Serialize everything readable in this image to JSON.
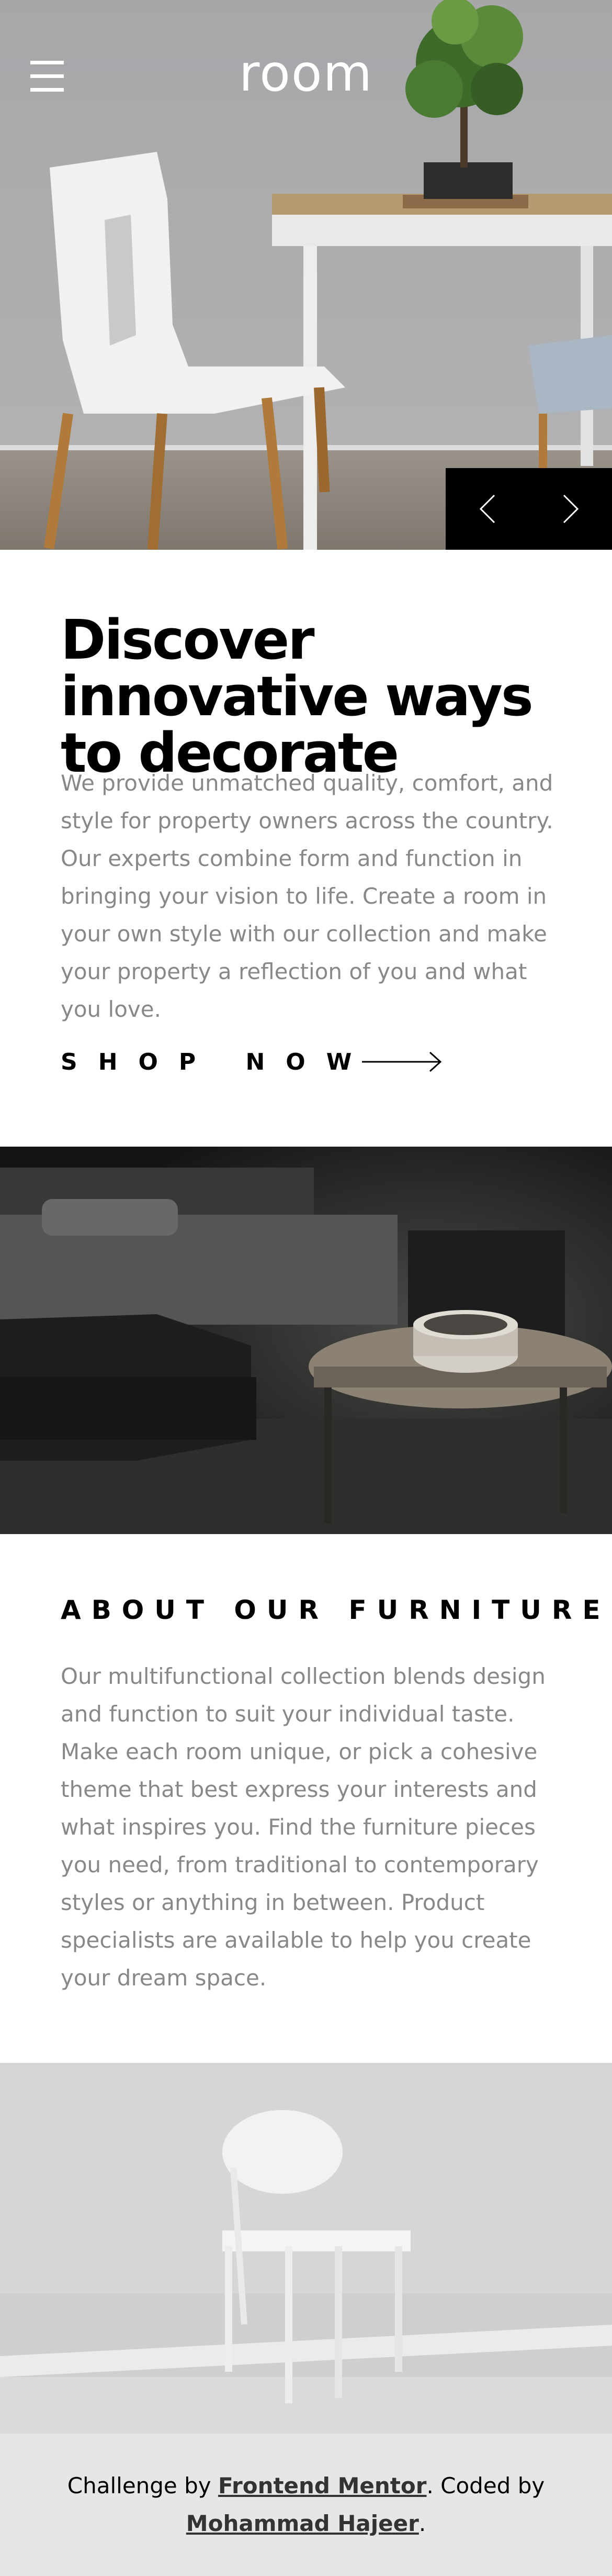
{
  "header": {
    "logo": "room",
    "menu_icon": "hamburger-menu-icon"
  },
  "slider": {
    "prev_icon": "chevron-left-icon",
    "next_icon": "chevron-right-icon"
  },
  "intro": {
    "title": "Discover innovative ways to decorate",
    "body": "We provide unmatched quality, comfort, and style for property owners across the country. Our experts combine form and function in bringing your vision to life. Create a room in your own style with our collection and make your property a reflection of you and what you love.",
    "cta_label": "SHOP NOW",
    "cta_icon": "arrow-right-icon"
  },
  "about": {
    "title": "ABOUT OUR FURNITURE",
    "body": "Our multifunctional collection blends design and function to suit your individual taste. Make each room unique, or pick a cohesive theme that best express your interests and what inspires you. Find the furniture pieces you need, from traditional to contemporary styles or anything in between. Product specialists are available to help you create your dream space."
  },
  "footer": {
    "prefix": "Challenge by ",
    "challenge_link": "Frontend Mentor",
    "middle": ". Coded by ",
    "author_link": "Mohammad Hajeer",
    "suffix": "."
  },
  "colors": {
    "body_text": "#888888",
    "heading": "#000000",
    "footer_bg": "#e6e6e6",
    "slider_bg": "#000000"
  }
}
